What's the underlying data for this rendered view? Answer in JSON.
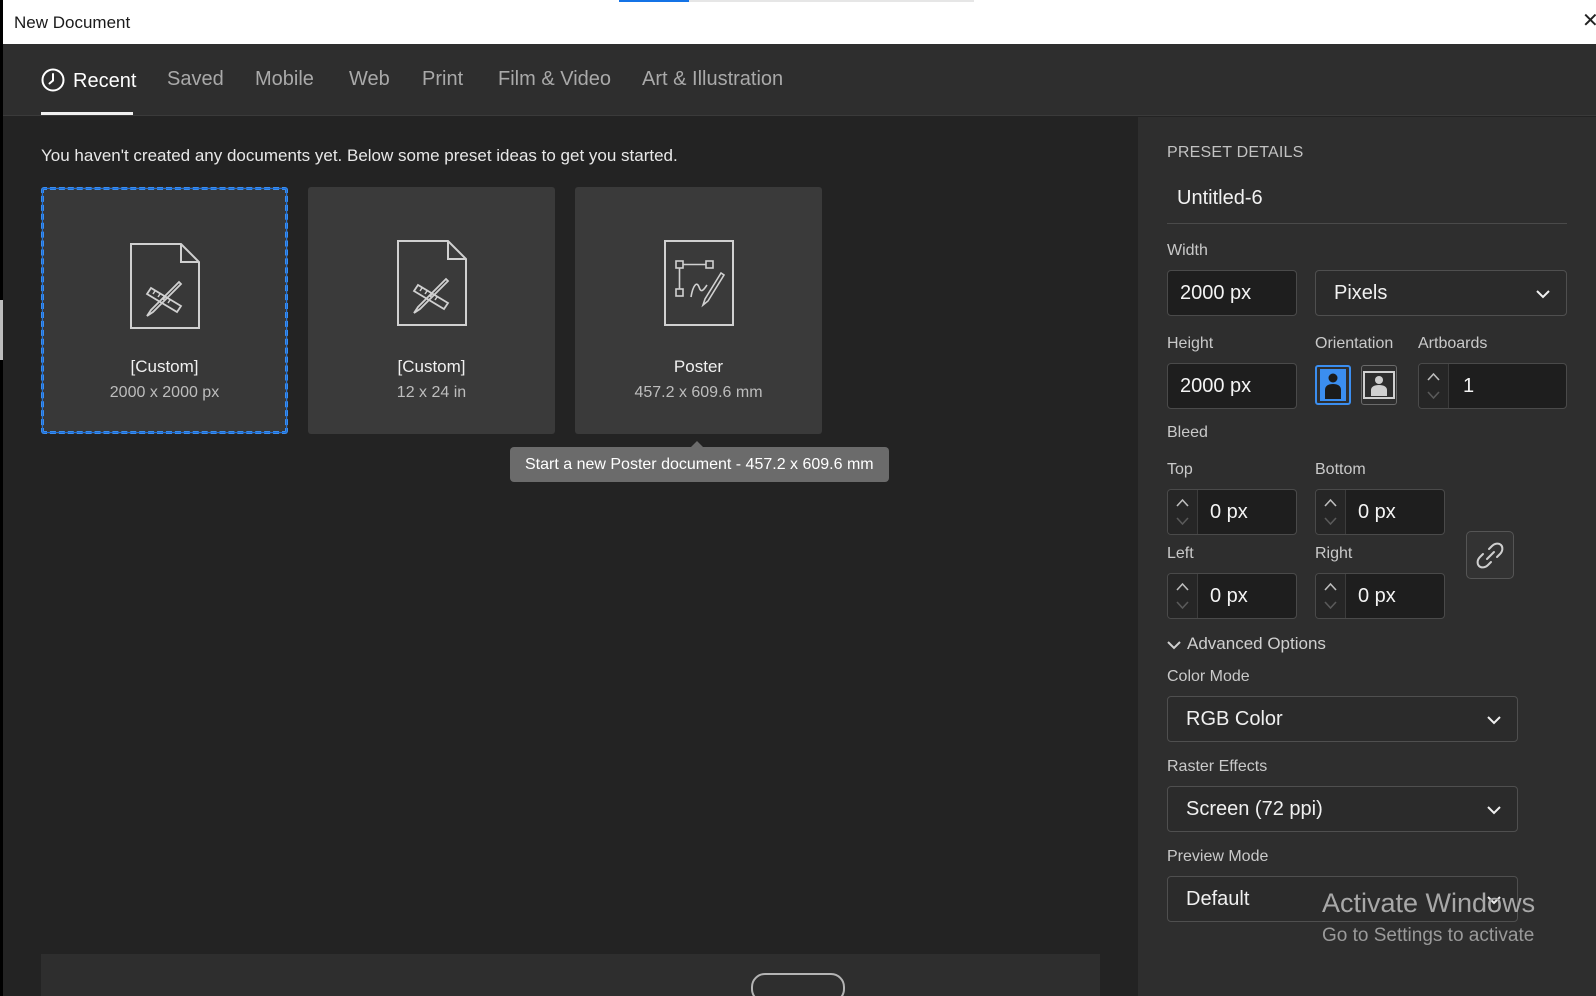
{
  "window": {
    "title": "New Document",
    "close_glyph": "✕"
  },
  "tabs": [
    {
      "label": "Recent",
      "active": true,
      "icon": "clock-icon"
    },
    {
      "label": "Saved"
    },
    {
      "label": "Mobile"
    },
    {
      "label": "Web"
    },
    {
      "label": "Print"
    },
    {
      "label": "Film & Video"
    },
    {
      "label": "Art & Illustration"
    }
  ],
  "left": {
    "hint": "You haven't created any documents yet. Below some preset ideas to get you started.",
    "cards": [
      {
        "name": "[Custom]",
        "size": "2000 x 2000 px",
        "icon": "document-ruler-pencil-icon",
        "selected": true
      },
      {
        "name": "[Custom]",
        "size": "12 x 24 in",
        "icon": "document-ruler-pencil-icon"
      },
      {
        "name": "Poster",
        "size": "457.2 x 609.6 mm",
        "icon": "poster-document-icon"
      }
    ],
    "tooltip": "Start a new Poster document - 457.2 x 609.6 mm"
  },
  "preset": {
    "heading": "PRESET DETAILS",
    "name": "Untitled-6",
    "width_label": "Width",
    "width_value": "2000 px",
    "units": "Pixels",
    "height_label": "Height",
    "height_value": "2000 px",
    "orientation_label": "Orientation",
    "artboards_label": "Artboards",
    "artboards_value": "1",
    "bleed_label": "Bleed",
    "top_label": "Top",
    "top_value": "0 px",
    "bottom_label": "Bottom",
    "bottom_value": "0 px",
    "left_label": "Left",
    "left_value": "0 px",
    "right_label": "Right",
    "right_value": "0 px",
    "advanced_label": "Advanced Options",
    "color_mode_label": "Color Mode",
    "color_mode_value": "RGB Color",
    "raster_label": "Raster Effects",
    "raster_value": "Screen (72 ppi)",
    "preview_label": "Preview Mode",
    "preview_value": "Default"
  },
  "watermark": {
    "line1": "Activate Windows",
    "line2": "Go to Settings to activate"
  },
  "colors": {
    "accent": "#1473e6",
    "panel": "#2e2e2e",
    "background": "#232323"
  }
}
